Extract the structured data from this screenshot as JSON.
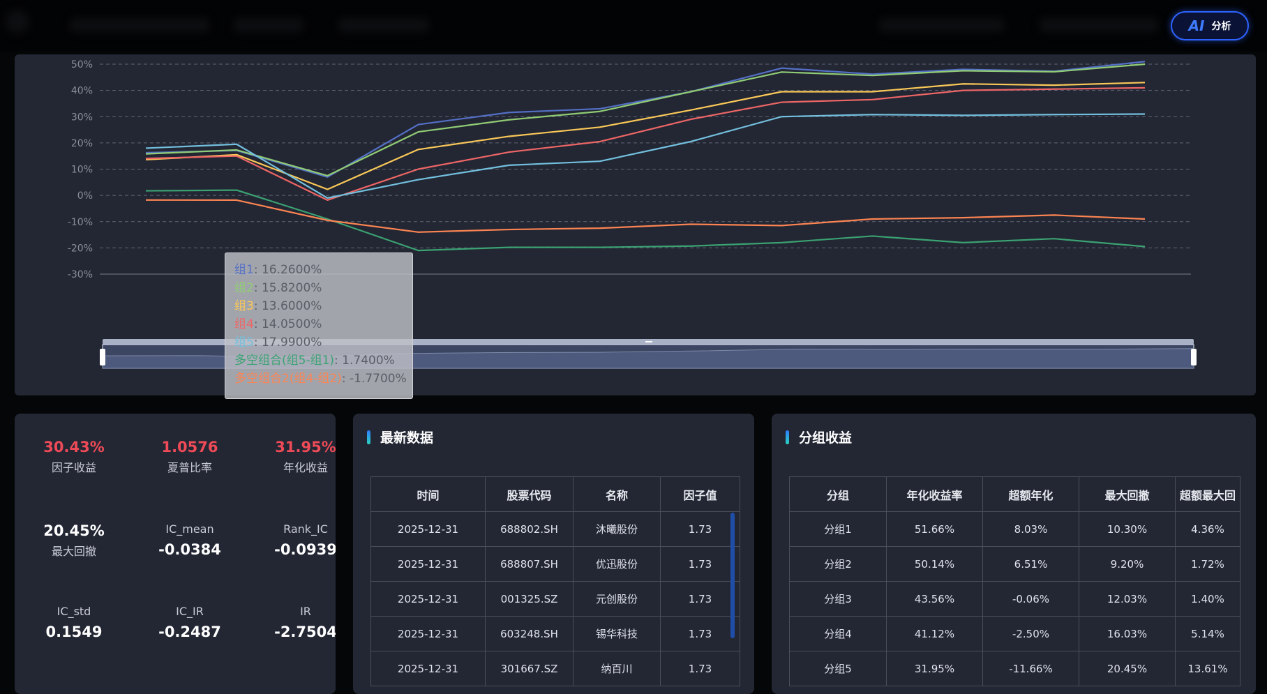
{
  "header": {
    "ai_button": {
      "icon": "ai-icon",
      "mark": "AI",
      "label": "分析",
      "accent": "#2e63ff"
    }
  },
  "chart_data": {
    "type": "line",
    "y_ticks": [
      "50%",
      "40%",
      "30%",
      "20%",
      "10%",
      "0%",
      "-10%",
      "-20%",
      "-30%"
    ],
    "ylim": [
      -30,
      50
    ],
    "x_count": 12,
    "grid": "horizontal dashed",
    "series": [
      {
        "name": "组1",
        "color": "#5470c6",
        "values": [
          16.26,
          17.1,
          7.0,
          27.0,
          31.6,
          33.0,
          39.5,
          48.5,
          46.2,
          48.0,
          47.3,
          51.0
        ]
      },
      {
        "name": "组2",
        "color": "#91cc75",
        "values": [
          15.82,
          17.3,
          7.5,
          24.2,
          28.8,
          32.0,
          39.5,
          47.0,
          45.7,
          47.5,
          47.1,
          50.0
        ]
      },
      {
        "name": "组3",
        "color": "#fac858",
        "values": [
          13.6,
          15.5,
          2.3,
          17.5,
          22.5,
          26.0,
          32.5,
          39.5,
          39.5,
          42.5,
          42.0,
          43.0
        ]
      },
      {
        "name": "组4",
        "color": "#ee6666",
        "values": [
          14.05,
          15.0,
          -1.8,
          10.0,
          16.5,
          20.5,
          29.0,
          35.5,
          36.5,
          40.0,
          40.5,
          41.0
        ]
      },
      {
        "name": "组5",
        "color": "#73c0de",
        "values": [
          17.99,
          19.5,
          -1.0,
          6.0,
          11.5,
          13.0,
          20.5,
          30.0,
          30.8,
          30.5,
          30.8,
          31.0
        ]
      },
      {
        "name": "多空组合(组5-组1)",
        "color": "#3ba272",
        "values": [
          1.74,
          2.0,
          -9.0,
          -21.0,
          -19.8,
          -19.8,
          -19.3,
          -18.0,
          -15.5,
          -18.0,
          -16.5,
          -19.5
        ]
      },
      {
        "name": "多空组合2(组4-组2)",
        "color": "#fc8452",
        "values": [
          -1.77,
          -1.8,
          -9.5,
          -14.0,
          -13.0,
          -12.5,
          -11.0,
          -11.5,
          -9.0,
          -8.5,
          -7.5,
          -9.0
        ]
      }
    ],
    "tooltip": {
      "rows": [
        {
          "name": "组1",
          "value": "16.2600%"
        },
        {
          "name": "组2",
          "value": "15.8200%"
        },
        {
          "name": "组3",
          "value": "13.6000%"
        },
        {
          "name": "组4",
          "value": "14.0500%"
        },
        {
          "name": "组5",
          "value": "17.9900%"
        },
        {
          "name": "多空组合(组5-组1)",
          "value": "1.7400%"
        },
        {
          "name": "多空组合2(组4-组2)",
          "value": "-1.7700%"
        }
      ]
    }
  },
  "stats": [
    {
      "value": "30.43%",
      "label": "因子收益",
      "tone": "red",
      "label_first": false
    },
    {
      "value": "1.0576",
      "label": "夏普比率",
      "tone": "red",
      "label_first": false
    },
    {
      "value": "31.95%",
      "label": "年化收益",
      "tone": "red",
      "label_first": false
    },
    {
      "value": "20.45%",
      "label": "最大回撤",
      "tone": "white",
      "label_first": false
    },
    {
      "value": "-0.0384",
      "label": "IC_mean",
      "tone": "white",
      "label_first": true
    },
    {
      "value": "-0.0939",
      "label": "Rank_IC",
      "tone": "white",
      "label_first": true
    },
    {
      "value": "0.1549",
      "label": "IC_std",
      "tone": "white",
      "label_first": true
    },
    {
      "value": "-0.2487",
      "label": "IC_IR",
      "tone": "white",
      "label_first": true
    },
    {
      "value": "-2.7504",
      "label": "IR",
      "tone": "white",
      "label_first": true
    }
  ],
  "latest": {
    "title": "最新数据",
    "columns": [
      "时间",
      "股票代码",
      "名称",
      "因子值"
    ],
    "rows": [
      [
        "2025-12-31",
        "688802.SH",
        "沐曦股份",
        "1.73"
      ],
      [
        "2025-12-31",
        "688807.SH",
        "优迅股份",
        "1.73"
      ],
      [
        "2025-12-31",
        "001325.SZ",
        "元创股份",
        "1.73"
      ],
      [
        "2025-12-31",
        "603248.SH",
        "锡华科技",
        "1.73"
      ],
      [
        "2025-12-31",
        "301667.SZ",
        "纳百川",
        "1.73"
      ]
    ]
  },
  "groups": {
    "title": "分组收益",
    "columns": [
      "分组",
      "年化收益率",
      "超额年化",
      "最大回撤",
      "超额最大回"
    ],
    "rows": [
      [
        "分组1",
        "51.66%",
        "8.03%",
        "10.30%",
        "4.36%"
      ],
      [
        "分组2",
        "50.14%",
        "6.51%",
        "9.20%",
        "1.72%"
      ],
      [
        "分组3",
        "43.56%",
        "-0.06%",
        "12.03%",
        "1.40%"
      ],
      [
        "分组4",
        "41.12%",
        "-2.50%",
        "16.03%",
        "5.14%"
      ],
      [
        "分组5",
        "31.95%",
        "-11.66%",
        "20.45%",
        "13.61%"
      ]
    ]
  }
}
